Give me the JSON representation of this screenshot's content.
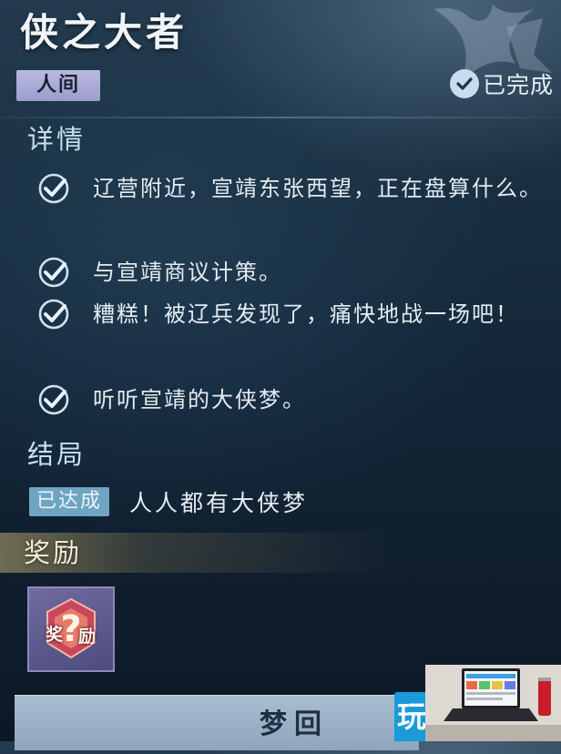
{
  "quest": {
    "title": "侠之大者",
    "realm_tag": "人间",
    "status": "已完成"
  },
  "details": {
    "label": "详情",
    "tasks": [
      {
        "text": "辽营附近，宣靖东张西望，正在盘算什么。",
        "done": true
      },
      {
        "text": "与宣靖商议计策。",
        "done": true
      },
      {
        "text": "糟糕！被辽兵发现了，痛快地战一场吧！",
        "done": true
      },
      {
        "text": "听听宣靖的大侠梦。",
        "done": true
      }
    ]
  },
  "ending": {
    "label": "结局",
    "badge": "已达成",
    "name": "人人都有大侠梦"
  },
  "rewards": {
    "label": "奖励",
    "item_chars": [
      "奖",
      "励"
    ],
    "item_icon": "mystery-reward-icon"
  },
  "actions": {
    "dream_label": "梦回"
  },
  "watermark": {
    "text": "玩"
  },
  "colors": {
    "realm_tag_bg": "#a9a9d6",
    "ending_badge_bg": "#6fa4c3",
    "button_bg": "#9db2c8",
    "check_color": "#cfe4f2"
  }
}
